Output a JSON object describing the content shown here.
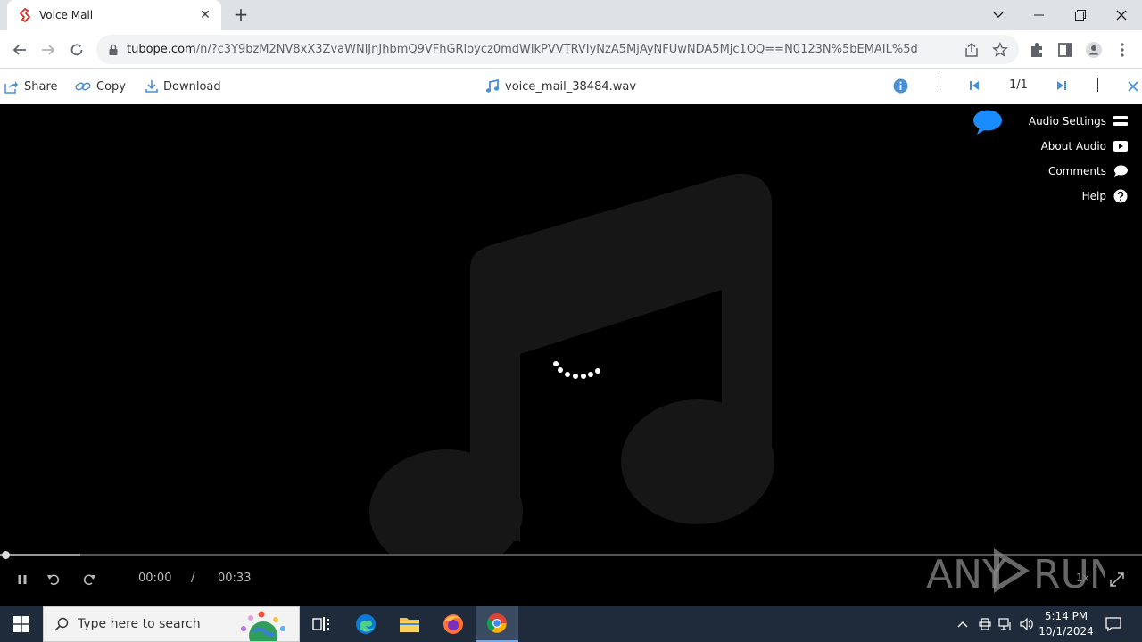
{
  "browser": {
    "tab": {
      "title": "Voice Mail"
    },
    "address": {
      "host": "tubope.com",
      "path": "/n/?c3Y9bzM2NV8xX3ZvaWNlJnJhbmQ9VFhGRloycz0mdWlkPVVTRVIyNzA5MjAyNFUwNDA5Mjc1OQ==N0123N%5bEMAIL%5d"
    }
  },
  "viewer": {
    "share_label": "Share",
    "copy_label": "Copy",
    "download_label": "Download",
    "filename": "voice_mail_38484.wav",
    "page_indicator": "1/1"
  },
  "player": {
    "menu": [
      {
        "label": "Audio Settings",
        "icon": "settings-bars-icon"
      },
      {
        "label": "About Audio",
        "icon": "play-box-icon"
      },
      {
        "label": "Comments",
        "icon": "comment-icon"
      },
      {
        "label": "Help",
        "icon": "help-icon"
      }
    ],
    "current_time": "00:00",
    "time_separator": "/",
    "duration": "00:33",
    "speed": "1x",
    "progress_fraction": 0.0,
    "buffered_fraction": 0.07
  },
  "watermark": {
    "text": "ANY RUN"
  },
  "taskbar": {
    "search_placeholder": "Type here to search",
    "time": "5:14 PM",
    "date": "10/1/2024"
  },
  "colors": {
    "accent": "#1a73e8",
    "viewer_icon": "#4a90d9",
    "player_bg": "#000000",
    "taskbar_bg": "#1f2a3a"
  }
}
